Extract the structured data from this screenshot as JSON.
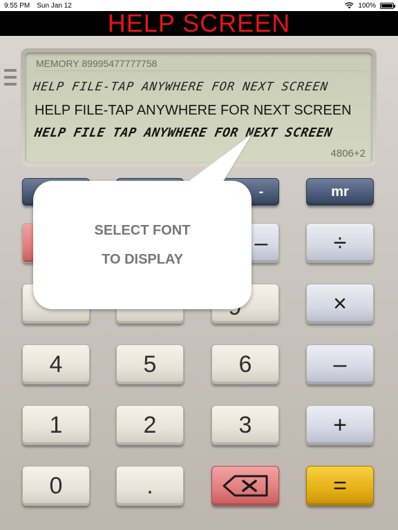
{
  "status_bar": {
    "time": "9:55 PM",
    "date": "Sun Jan 12",
    "battery": "100%",
    "battery_level": 1.0
  },
  "header": {
    "title": "HELP SCREEN"
  },
  "display": {
    "memory": "MEMORY 89995477777758",
    "line_1": "HELP FILE-TAP ANYWHERE FOR NEXT SCREEN",
    "line_2": "HELP FILE-TAP ANYWHERE FOR NEXT SCREEN",
    "line_3": "HELP FILE TAP ANYWHERE FOR NEXT SCREEN",
    "counter": "4806+2"
  },
  "keypad": {
    "row_mem": {
      "m_minus": "-",
      "mr": "mr"
    },
    "row_ops": {
      "minus_partial": "–",
      "divide": "÷"
    },
    "row_1": {
      "nine_partial": "9",
      "multiply": "×"
    },
    "row_2": {
      "four": "4",
      "five": "5",
      "six": "6",
      "minus": "–"
    },
    "row_3": {
      "one": "1",
      "two": "2",
      "three": "3",
      "plus": "+"
    },
    "row_4": {
      "zero": "0",
      "dot": ".",
      "backspace": "⌫",
      "equals": "="
    }
  },
  "tooltip": {
    "line_1": "SELECT FONT",
    "line_2": "TO DISPLAY"
  },
  "colors": {
    "header_text": "#e8141a",
    "lcd_background": "#d4d7c1",
    "mem_keys": "#4a5b78",
    "backspace_key": "#e27c7c",
    "equals_key": "#e6b015"
  },
  "icons": {
    "menu": "menu-icon",
    "wifi": "wifi-icon",
    "battery": "battery-icon",
    "backspace": "backspace-icon"
  }
}
